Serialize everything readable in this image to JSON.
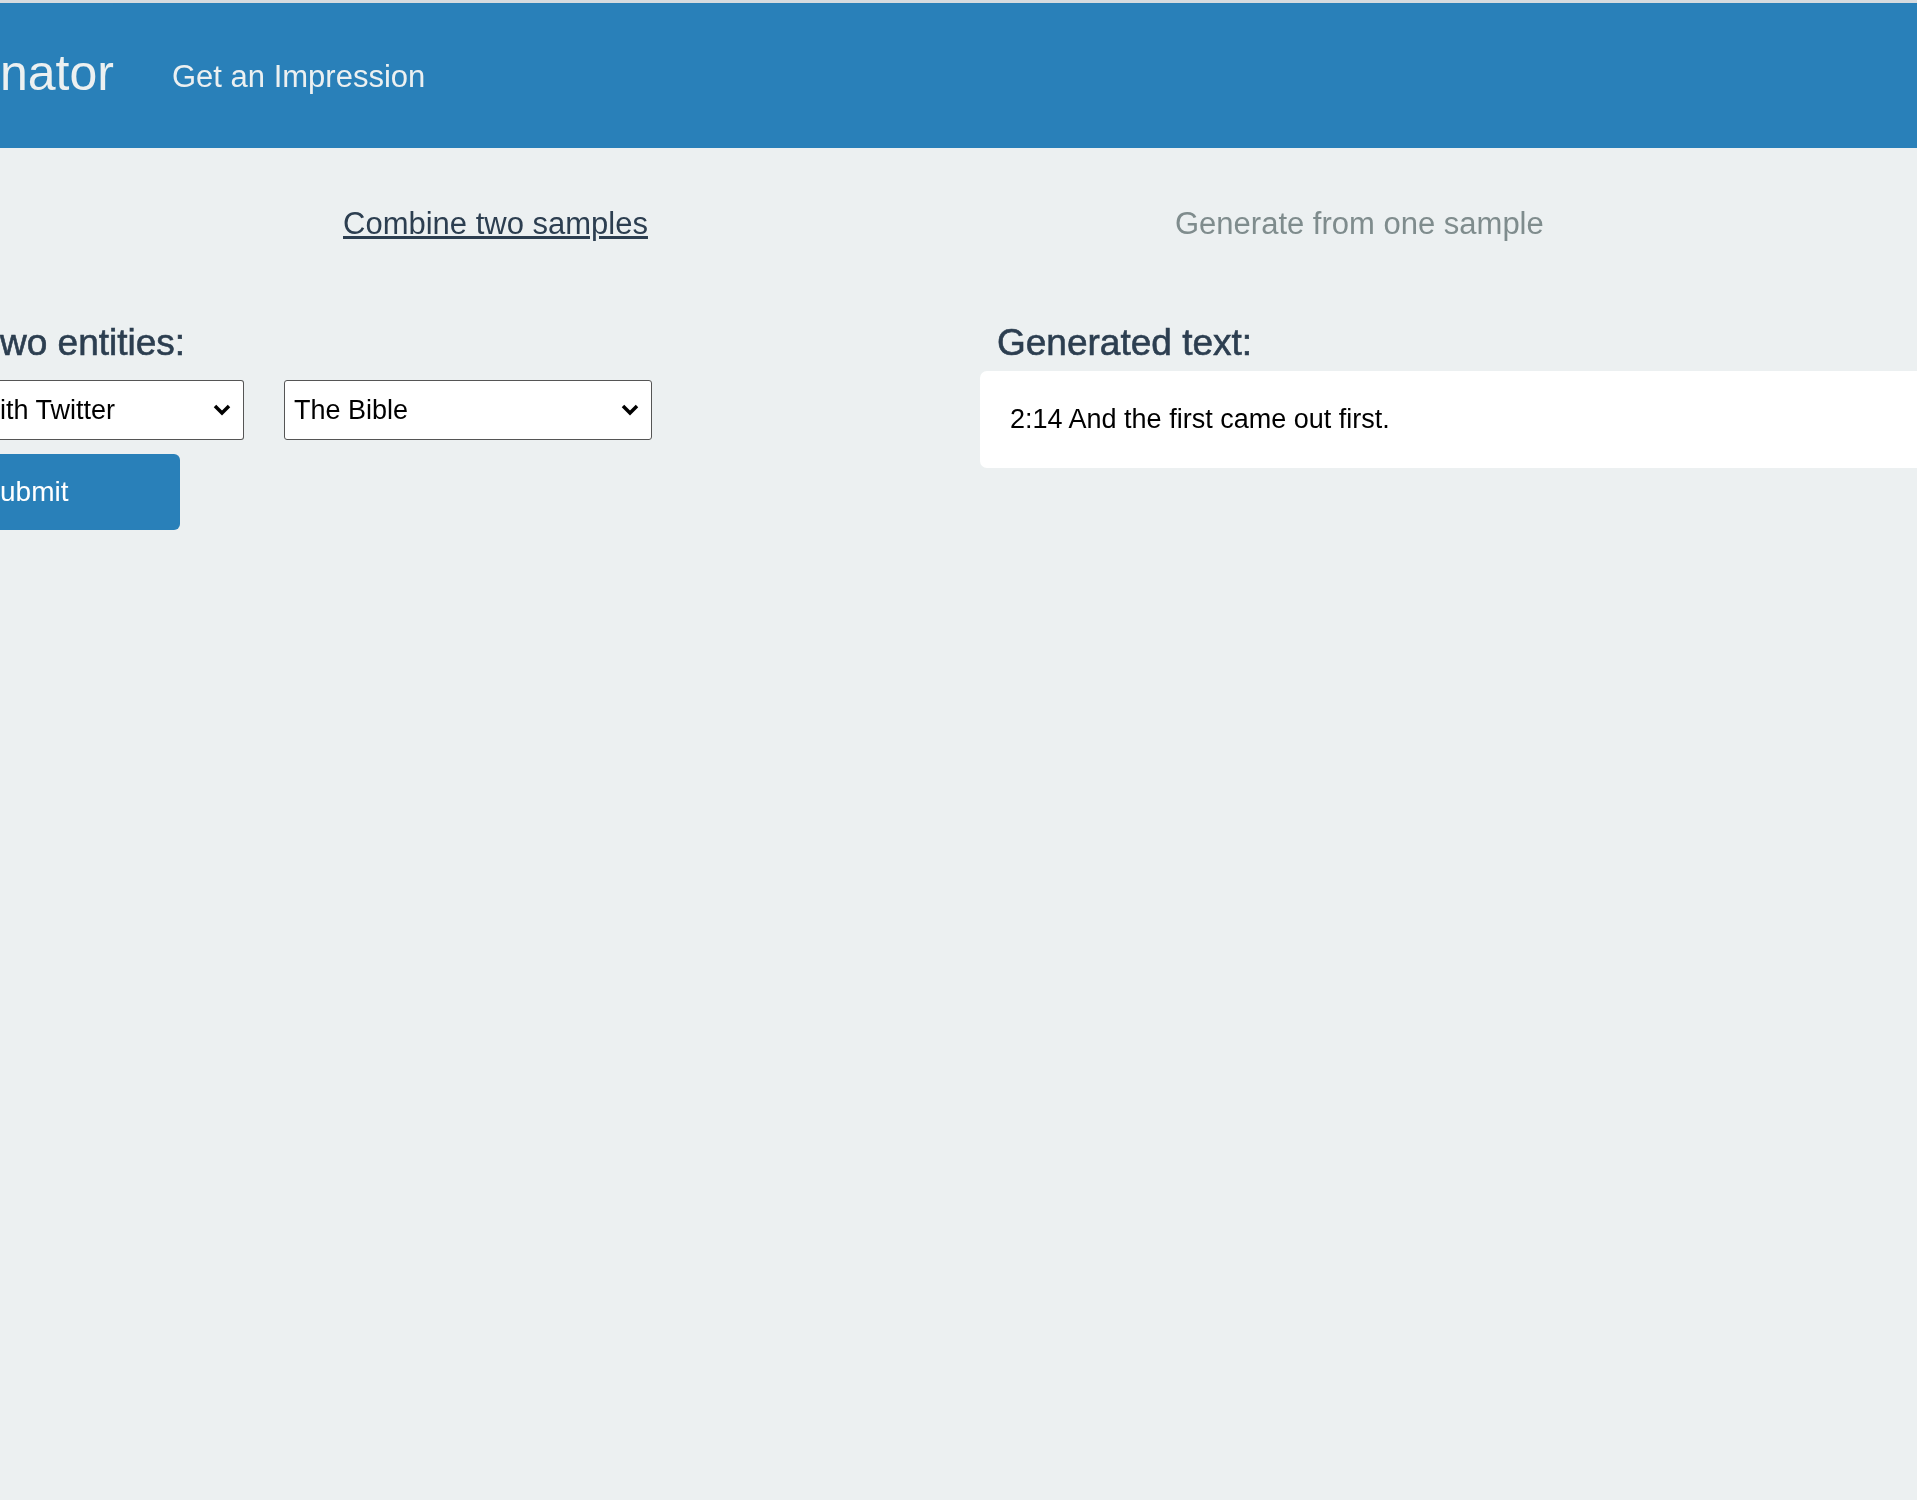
{
  "header": {
    "brand": "nator",
    "nav_link": "Get an Impression"
  },
  "tabs": [
    {
      "label": "Combine two samples",
      "selected": true
    },
    {
      "label": "Generate from one sample",
      "selected": false
    }
  ],
  "form": {
    "heading": "wo entities:",
    "selects": [
      {
        "value": "ith Twitter"
      },
      {
        "value": "The Bible"
      }
    ],
    "submit": "ubmit"
  },
  "output": {
    "heading": "Generated text:",
    "text": "2:14 And the first came out first."
  }
}
